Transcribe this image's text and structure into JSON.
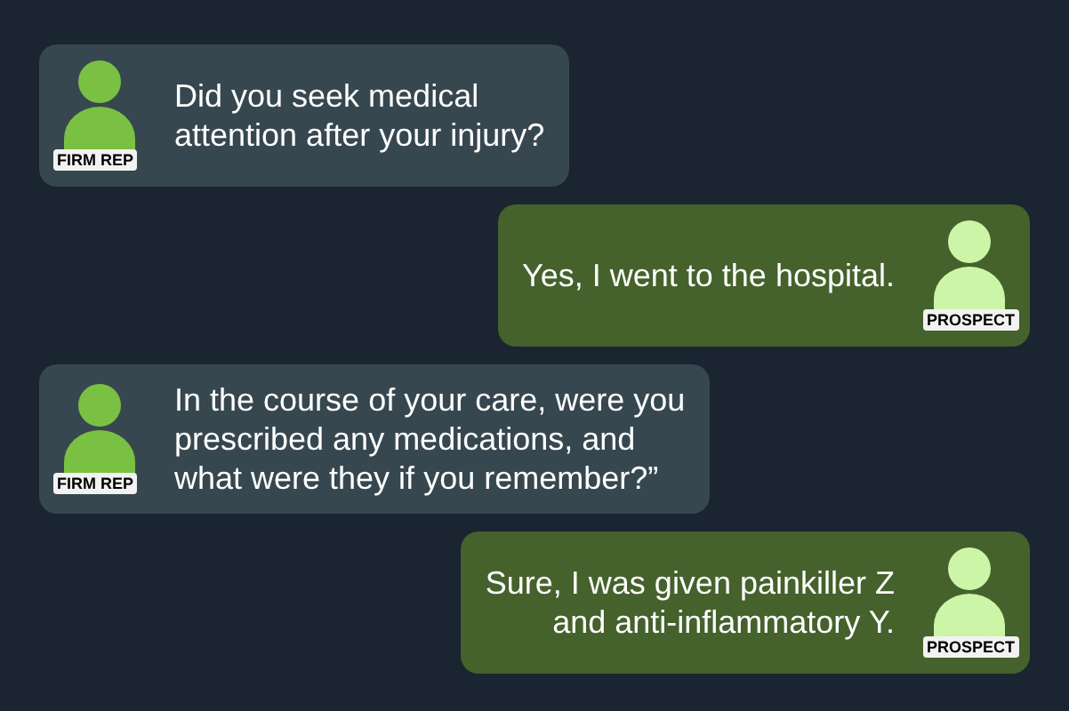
{
  "messages": [
    {
      "kind": "rep",
      "role": "FIRM REP",
      "text": "Did you seek medical\nattention after your injury?"
    },
    {
      "kind": "prospect",
      "role": "PROSPECT",
      "text": "Yes, I went to the hospital."
    },
    {
      "kind": "rep",
      "role": "FIRM REP",
      "text": "In the course of your care, were you\nprescribed any medications, and\nwhat were they if you remember?”"
    },
    {
      "kind": "prospect",
      "role": "PROSPECT",
      "text": "Sure, I was given painkiller Z\nand anti-inflammatory Y."
    }
  ]
}
